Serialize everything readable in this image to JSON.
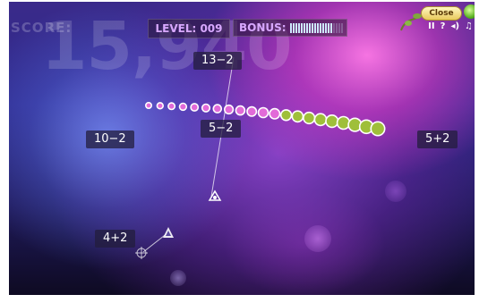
{
  "hud": {
    "score_label": "SCORE:",
    "score_value": "15,940",
    "level_text": "LEVEL: 009",
    "bonus_label": "BONUS:",
    "bonus_fill": 0.78
  },
  "controls": {
    "close_label": "Close",
    "pause_glyph": "II",
    "help_glyph": "?",
    "sound_glyph": "◂)",
    "music_glyph": "♫"
  },
  "expressions": [
    {
      "id": "expr-13-2",
      "text": "13−2"
    },
    {
      "id": "expr-5-2",
      "text": "5−2"
    },
    {
      "id": "expr-10-2",
      "text": "10−2"
    },
    {
      "id": "expr-5p2",
      "text": "5+2"
    },
    {
      "id": "expr-4p2",
      "text": "4+2"
    }
  ],
  "colors": {
    "orb_pink": "#e26ad8",
    "orb_green": "#9fbf3a",
    "laser": "#ffffff"
  }
}
